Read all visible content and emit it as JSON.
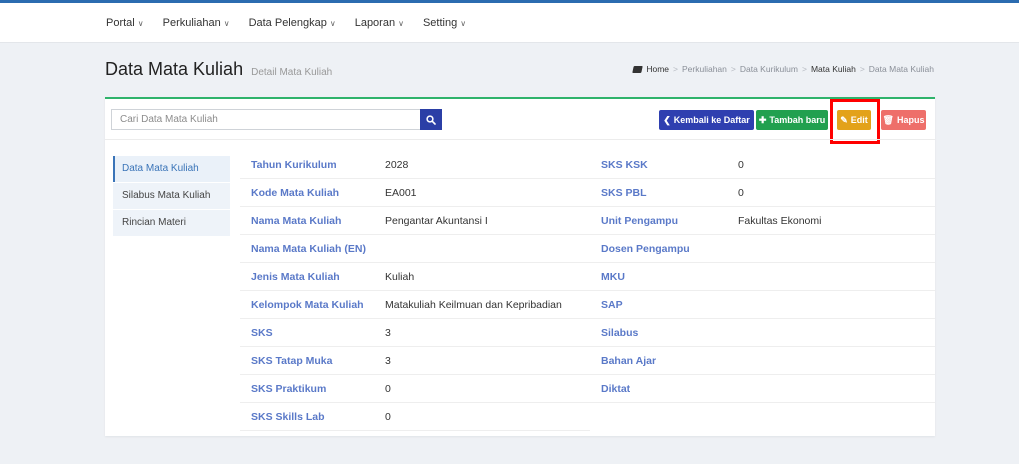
{
  "topnav": {
    "items": [
      {
        "label": "Portal"
      },
      {
        "label": "Perkuliahan"
      },
      {
        "label": "Data Pelengkap"
      },
      {
        "label": "Laporan"
      },
      {
        "label": "Setting"
      }
    ],
    "caret": "∨"
  },
  "header": {
    "title": "Data Mata Kuliah",
    "subtitle": "Detail Mata Kuliah"
  },
  "breadcrumb": {
    "items": [
      "Home",
      "Perkuliahan",
      "Data Kurikulum",
      "Mata Kuliah",
      "Data Mata Kuliah"
    ],
    "separator": ">"
  },
  "search": {
    "placeholder": "Cari Data Mata Kuliah",
    "value": ""
  },
  "actions": {
    "back_label": "Kembali ke Daftar",
    "add_label": "Tambah baru",
    "edit_label": "Edit",
    "delete_label": "Hapus"
  },
  "sidebar": {
    "items": [
      {
        "label": "Data Mata Kuliah",
        "active": true
      },
      {
        "label": "Silabus Mata Kuliah",
        "active": false
      },
      {
        "label": "Rincian Materi",
        "active": false
      }
    ]
  },
  "details": {
    "left": [
      {
        "label": "Tahun Kurikulum",
        "value": "2028"
      },
      {
        "label": "Kode Mata Kuliah",
        "value": "EA001"
      },
      {
        "label": "Nama Mata Kuliah",
        "value": "Pengantar Akuntansi I"
      },
      {
        "label": "Nama Mata Kuliah (EN)",
        "value": ""
      },
      {
        "label": "Jenis Mata Kuliah",
        "value": "Kuliah"
      },
      {
        "label": "Kelompok Mata Kuliah",
        "value": "Matakuliah Keilmuan dan Kepribadian"
      },
      {
        "label": "SKS",
        "value": "3"
      },
      {
        "label": "SKS Tatap Muka",
        "value": "3"
      },
      {
        "label": "SKS Praktikum",
        "value": "0"
      },
      {
        "label": "SKS Skills Lab",
        "value": "0"
      }
    ],
    "right": [
      {
        "label": "SKS KSK",
        "value": "0"
      },
      {
        "label": "SKS PBL",
        "value": "0"
      },
      {
        "label": "Unit Pengampu",
        "value": "Fakultas Ekonomi"
      },
      {
        "label": "Dosen Pengampu",
        "value": ""
      },
      {
        "label": "MKU",
        "value": ""
      },
      {
        "label": "SAP",
        "value": ""
      },
      {
        "label": "Silabus",
        "value": ""
      },
      {
        "label": "Bahan Ajar",
        "value": ""
      },
      {
        "label": "Diktat",
        "value": ""
      }
    ]
  },
  "colors": {
    "accent_blue": "#2f3fb0",
    "success_green": "#21a04f",
    "warning_orange": "#e3a21a",
    "danger_red": "#ee6f6a",
    "label_blue": "#5a79c8",
    "highlight_red": "#ff0000"
  }
}
